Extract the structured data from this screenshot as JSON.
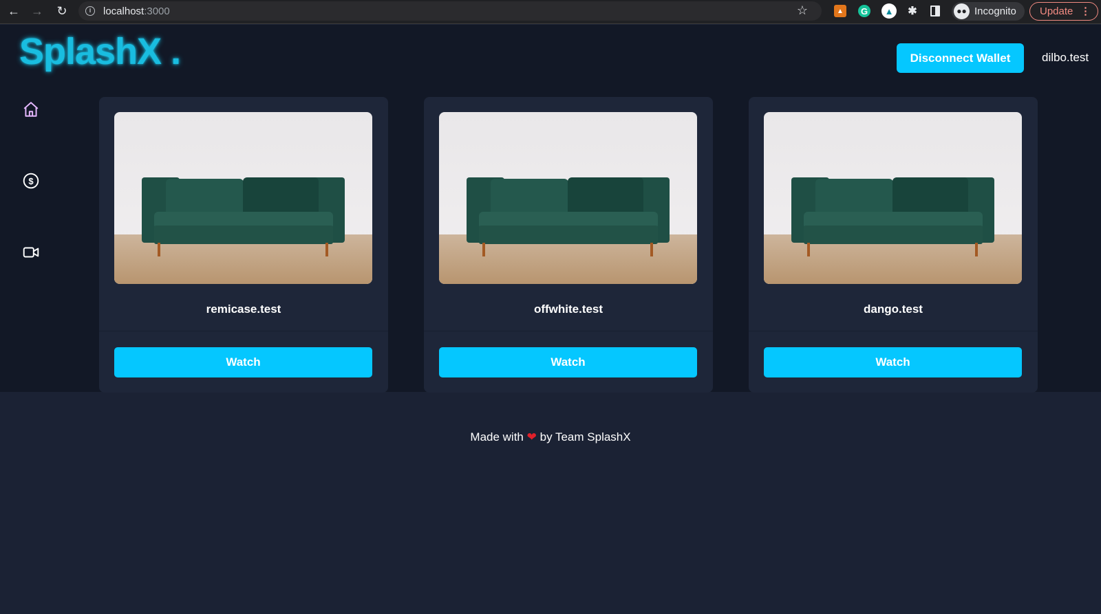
{
  "browser": {
    "url_host": "localhost",
    "url_port": ":3000",
    "incognito_label": "Incognito",
    "update_label": "Update",
    "extensions": [
      "metamask-icon",
      "grammarly-icon",
      "vpn-icon",
      "extensions-puzzle-icon",
      "side-panel-icon"
    ]
  },
  "app": {
    "logo": "SplashX .",
    "disconnect_label": "Disconnect Wallet",
    "username": "dilbo.test",
    "accent_color": "#05c7ff"
  },
  "sidebar": {
    "items": [
      {
        "icon": "home-icon",
        "color": "#e6b8ff"
      },
      {
        "icon": "dollar-icon",
        "color": "#ffffff"
      },
      {
        "icon": "video-icon",
        "color": "#ffffff"
      }
    ]
  },
  "cards": [
    {
      "name": "remicase.test",
      "button": "Watch"
    },
    {
      "name": "offwhite.test",
      "button": "Watch"
    },
    {
      "name": "dango.test",
      "button": "Watch"
    }
  ],
  "footer": {
    "prefix": "Made with",
    "heart": "❤",
    "suffix": "by Team SplashX"
  }
}
